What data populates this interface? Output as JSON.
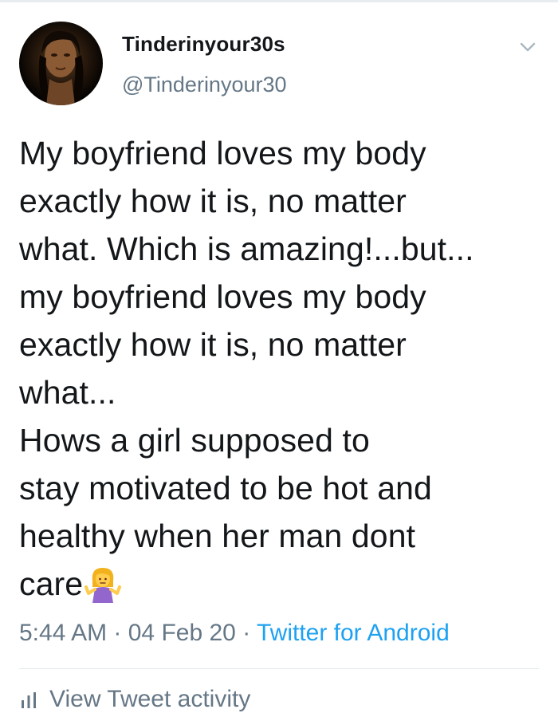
{
  "user": {
    "display_name": "Tinderinyour30s",
    "handle": "@Tinderinyour30",
    "avatar_icon": "profile-photo"
  },
  "tweet": {
    "lines": [
      "My boyfriend loves my body",
      "exactly how it is, no matter",
      "what. Which is amazing!...but...",
      "my boyfriend loves my body",
      "exactly how it is, no matter",
      "what...",
      "Hows a girl supposed to",
      "stay motivated to be hot and",
      "healthy when her man dont",
      "care"
    ],
    "emoji": "woman-shrugging-emoji"
  },
  "meta": {
    "time": "5:44 AM",
    "separator": " · ",
    "date": "04 Feb 20",
    "source": "Twitter for Android"
  },
  "activity": {
    "label": "View Tweet activity",
    "icon": "bar-chart-icon"
  },
  "colors": {
    "text": "#14171a",
    "secondary": "#657786",
    "link": "#1da1f2",
    "divider": "#e1e8ed"
  }
}
